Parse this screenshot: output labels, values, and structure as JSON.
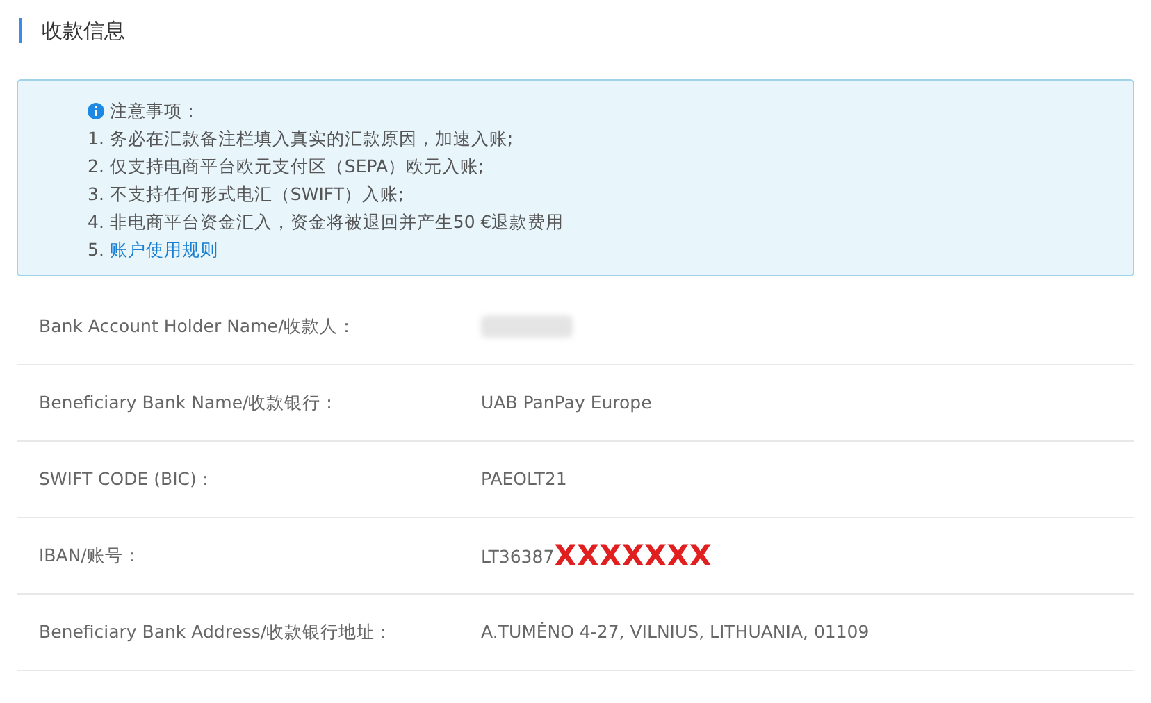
{
  "section": {
    "title": "收款信息"
  },
  "notice": {
    "heading": "注意事项：",
    "items": [
      {
        "text": "1. 务必在汇款备注栏填入真实的汇款原因，加速入账;",
        "kind": "text"
      },
      {
        "text": "2. 仅支持电商平台欧元支付区（SEPA）欧元入账;",
        "kind": "text"
      },
      {
        "text": "3. 不支持任何形式电汇（SWIFT）入账;",
        "kind": "text"
      },
      {
        "text": "4. 非电商平台资金汇入，资金将被退回并产生50 €退款费用",
        "kind": "text"
      },
      {
        "text": "5. ",
        "link": "账户使用规则",
        "kind": "link"
      }
    ]
  },
  "rows": [
    {
      "label": "Bank Account Holder Name/收款人：",
      "kind": "blurred"
    },
    {
      "label": "Beneficiary Bank Name/收款银行：",
      "value": "UAB PanPay Europe",
      "kind": "text"
    },
    {
      "label": "SWIFT CODE (BIC)：",
      "value": "PAEOLT21",
      "kind": "text"
    },
    {
      "label": "IBAN/账号：",
      "value": "LT36387",
      "redaction": "XXXXXXX",
      "kind": "redacted"
    },
    {
      "label": "Beneficiary Bank Address/收款银行地址：",
      "value": "A.TUMĖNO 4-27, VILNIUS, LITHUANIA, 01109",
      "kind": "text"
    }
  ]
}
